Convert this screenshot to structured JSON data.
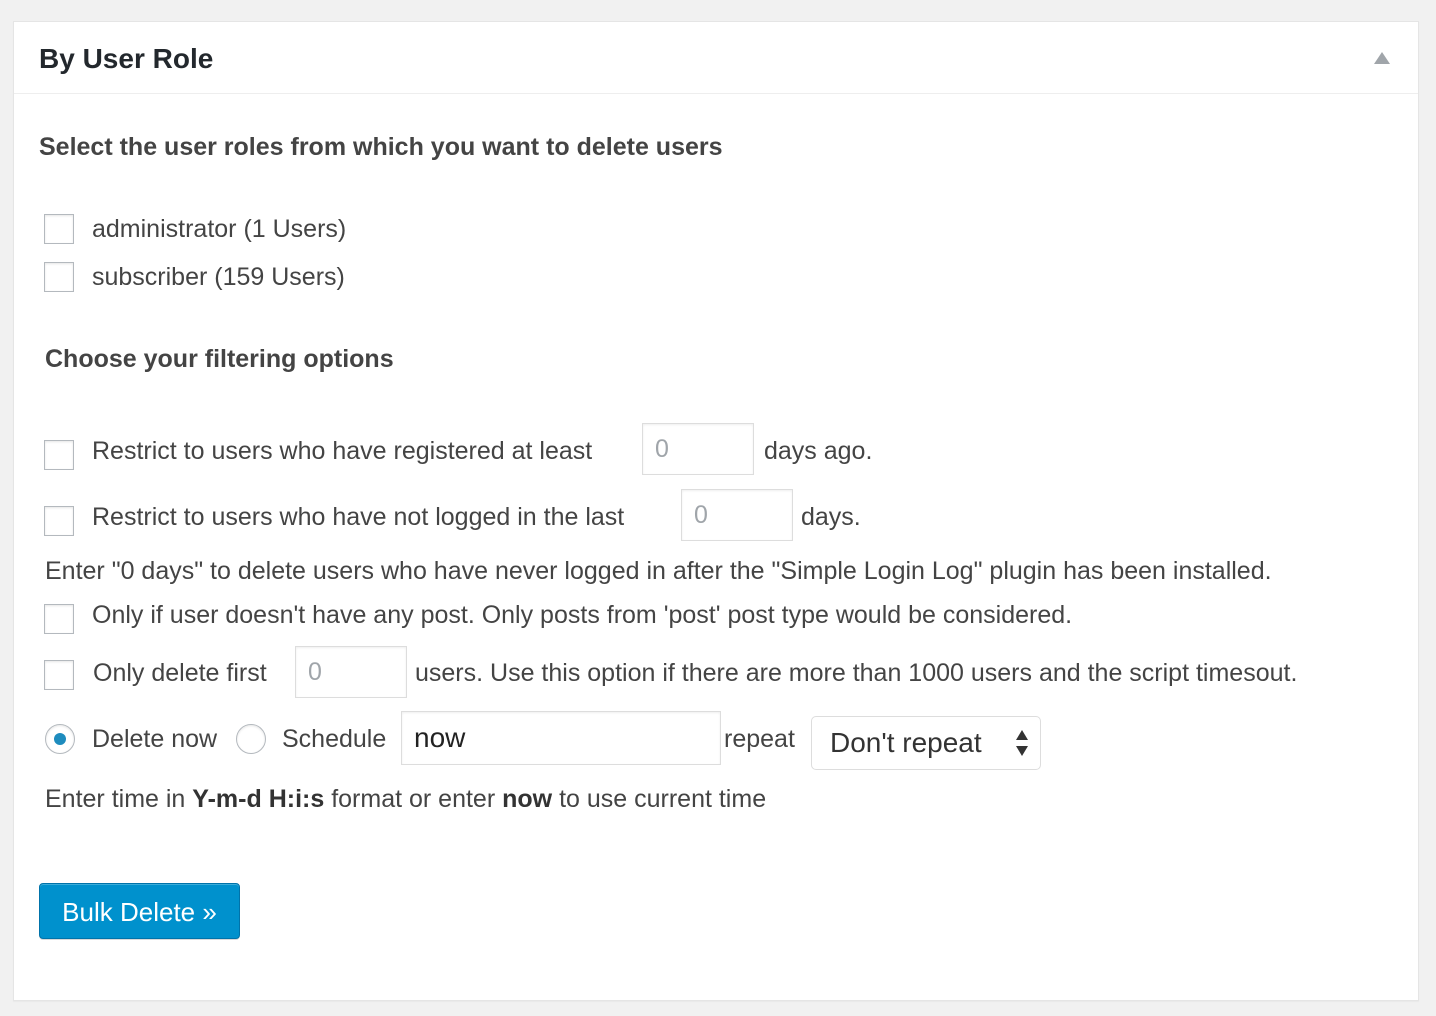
{
  "panel": {
    "title": "By User Role",
    "toggle_icon": "triangle-up-icon"
  },
  "roles": {
    "heading": "Select the user roles from which you want to delete users",
    "items": [
      {
        "label": "administrator (1 Users)",
        "checked": false
      },
      {
        "label": "subscriber (159 Users)",
        "checked": false
      }
    ]
  },
  "filters": {
    "heading": "Choose your filtering options",
    "registered": {
      "prefix": "Restrict to users who have registered at least",
      "placeholder": "0",
      "suffix": "days ago."
    },
    "not_logged": {
      "prefix": "Restrict to users who have not logged in the last",
      "placeholder": "0",
      "suffix": "days."
    },
    "login_note": "Enter \"0 days\" to delete users who have never logged in after the \"Simple Login Log\" plugin has been installed.",
    "no_post": {
      "label": "Only if user doesn't have any post. Only posts from 'post' post type would be considered."
    },
    "limit": {
      "prefix": "Only delete first",
      "placeholder": "0",
      "suffix": "users. Use this option if there are more than 1000 users and the script timesout."
    }
  },
  "schedule": {
    "delete_now_label": "Delete now",
    "schedule_label": "Schedule",
    "time_value": "now",
    "repeat_label": "repeat",
    "repeat_selected": "Don't repeat",
    "note_prefix": "Enter time in",
    "note_format": "Y-m-d H:i:s",
    "note_middle": "format or enter",
    "note_now": "now",
    "note_suffix": "to use current time"
  },
  "actions": {
    "submit_label": "Bulk Delete »"
  },
  "colors": {
    "primary_button": "#0091cd",
    "radio_dot": "#1e8cbe"
  }
}
